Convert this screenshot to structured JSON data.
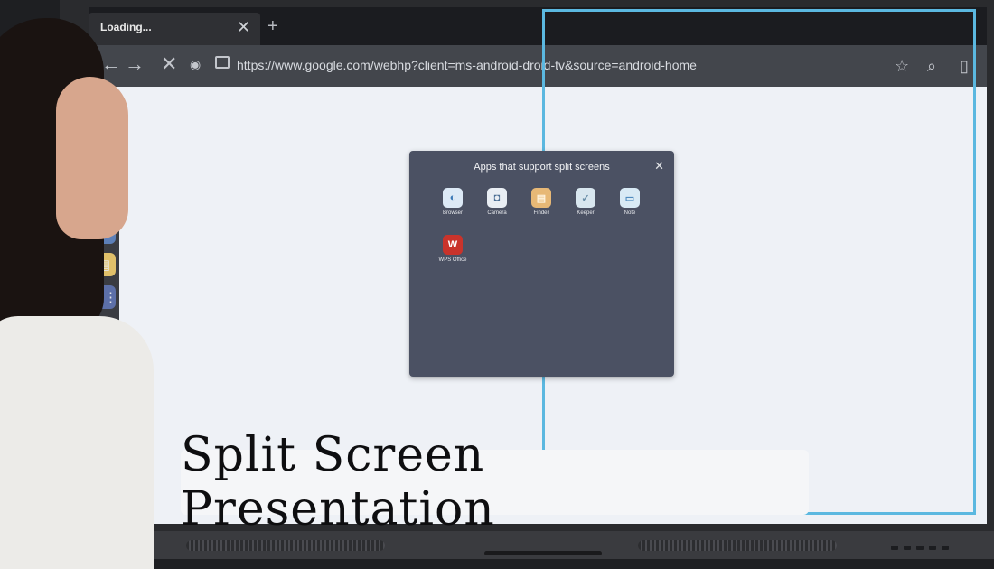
{
  "browser": {
    "tab_title": "Loading...",
    "url": "https://www.google.com/webhp?client=ms-android-droid-tv&source=android-home"
  },
  "dialog": {
    "title": "Apps that support split screens",
    "apps": [
      {
        "label": "Browser",
        "icon": "browser-icon",
        "color": "#dce9f6"
      },
      {
        "label": "Camera",
        "icon": "camera-icon",
        "color": "#e9eef4"
      },
      {
        "label": "Finder",
        "icon": "folder-icon",
        "color": "#e7b876"
      },
      {
        "label": "Keeper",
        "icon": "keeper-icon",
        "color": "#d8e6ef"
      },
      {
        "label": "Note",
        "icon": "note-icon",
        "color": "#d8eaf5"
      },
      {
        "label": "WPS Office",
        "icon": "wps-office-icon",
        "color": "#c9332b"
      }
    ]
  },
  "caption": "Split Screen Presentation",
  "colors": {
    "split_frame": "#5bb8e0",
    "dialog_bg": "#4b5163"
  }
}
